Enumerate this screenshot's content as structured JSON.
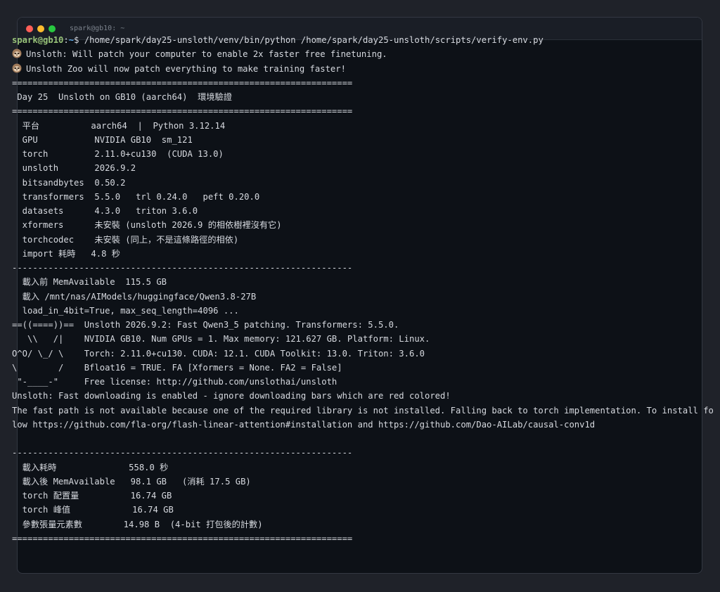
{
  "window": {
    "title": "spark@gb10: ~",
    "colors": {
      "close": "#ff5f57",
      "minimize": "#febc2e",
      "maximize": "#28c840"
    }
  },
  "prompt": {
    "user_host": "spark@gb10",
    "separator": ":",
    "path": "~",
    "symbol": "$ ",
    "command": "/home/spark/day25-unsloth/venv/bin/python /home/spark/day25-unsloth/scripts/verify-env.py"
  },
  "banner": {
    "line1": "Unsloth: Will patch your computer to enable 2x faster free finetuning.",
    "line2": "Unsloth Zoo will now patch everything to make training faster!",
    "icon": "sloth-icon"
  },
  "lines": [
    "==================================================================",
    " Day 25  Unsloth on GB10 (aarch64)  環境驗證",
    "==================================================================",
    "  平台          aarch64  |  Python 3.12.14",
    "  GPU           NVIDIA GB10  sm_121",
    "  torch         2.11.0+cu130  (CUDA 13.0)",
    "  unsloth       2026.9.2",
    "  bitsandbytes  0.50.2",
    "  transformers  5.5.0   trl 0.24.0   peft 0.20.0",
    "  datasets      4.3.0   triton 3.6.0",
    "  xformers      未安裝 (unsloth 2026.9 的相依樹裡沒有它)",
    "  torchcodec    未安裝 (同上，不是這條路徑的相依)",
    "  import 耗時   4.8 秒",
    "------------------------------------------------------------------",
    "  載入前 MemAvailable  115.5 GB",
    "  載入 /mnt/nas/AIModels/huggingface/Qwen3.8-27B",
    "  load_in_4bit=True, max_seq_length=4096 ...",
    "==((====))==  Unsloth 2026.9.2: Fast Qwen3_5 patching. Transformers: 5.5.0.",
    "   \\\\   /|    NVIDIA GB10. Num GPUs = 1. Max memory: 121.627 GB. Platform: Linux.",
    "O^O/ \\_/ \\    Torch: 2.11.0+cu130. CUDA: 12.1. CUDA Toolkit: 13.0. Triton: 3.6.0",
    "\\        /    Bfloat16 = TRUE. FA [Xformers = None. FA2 = False]",
    " \"-____-\"     Free license: http://github.com/unslothai/unsloth",
    "Unsloth: Fast downloading is enabled - ignore downloading bars which are red colored!",
    "The fast path is not available because one of the required library is not installed. Falling back to torch implementation. To install fol",
    "low https://github.com/fla-org/flash-linear-attention#installation and https://github.com/Dao-AILab/causal-conv1d",
    "",
    "------------------------------------------------------------------",
    "  載入耗時              558.0 秒",
    "  載入後 MemAvailable   98.1 GB   (消耗 17.5 GB)",
    "  torch 配置量          16.74 GB",
    "  torch 峰值            16.74 GB",
    "  參數張量元素數        14.98 B  (4-bit 打包後的計數)",
    "=================================================================="
  ]
}
